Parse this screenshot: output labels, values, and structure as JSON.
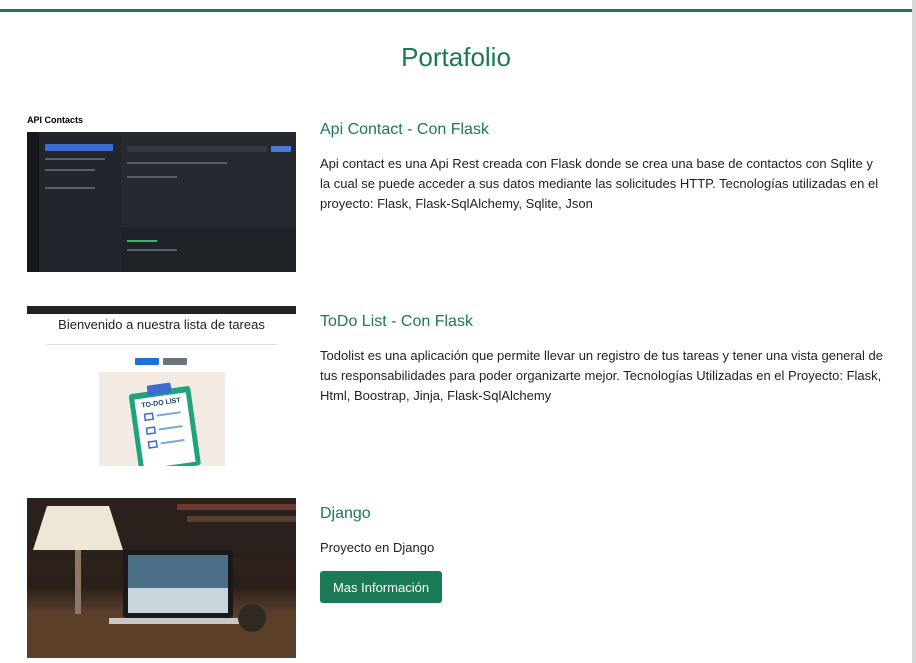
{
  "page": {
    "title": "Portafolio"
  },
  "projects": [
    {
      "title": "Api Contact - Con Flask",
      "description": "Api contact es una Api Rest creada con Flask donde se crea una base de contactos con Sqlite y la cual se puede acceder a sus datos mediante las solicitudes HTTP. Tecnologías utilizadas en el proyecto: Flask, Flask-SqlAlchemy, Sqlite, Json",
      "thumbnail": {
        "caption": "API Contacts"
      }
    },
    {
      "title": "ToDo List - Con Flask",
      "description": "Todolist es una aplicación que permite llevar un registro de tus tareas y tener una vista general de tus responsabilidades para poder organizarte mejor. Tecnologías Utilizadas en el Proyecto: Flask, Html, Boostrap, Jinja, Flask-SqlAlchemy",
      "thumbnail": {
        "heading": "Bienvenido a nuestra lista de tareas",
        "board_label": "TO-DO LIST"
      }
    },
    {
      "title": "Django",
      "description": "Proyecto en Django",
      "button_label": "Mas Información"
    }
  ],
  "colors": {
    "accent": "#1a7a55",
    "text": "#222222"
  }
}
